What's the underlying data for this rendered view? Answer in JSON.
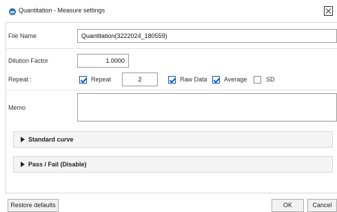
{
  "window": {
    "title": "Quantitation - Measure settings",
    "app_icon": "app-logo-icon",
    "close_icon": "close-icon"
  },
  "form": {
    "file_name": {
      "label": "File Name",
      "value": "Quantitation(3222024_180559)"
    },
    "dilution_factor": {
      "label": "Dilution Factor",
      "value": "1.0000"
    },
    "repeat": {
      "label": "Repeat :",
      "repeat_checkbox": {
        "label": "Repeat",
        "checked": true
      },
      "count": "2",
      "raw_data": {
        "label": "Raw Data",
        "checked": true
      },
      "average": {
        "label": "Average",
        "checked": true
      },
      "sd": {
        "label": "SD",
        "checked": false
      }
    },
    "memo": {
      "label": "Memo",
      "value": ""
    }
  },
  "sections": {
    "standard_curve": {
      "label": "Standard curve",
      "icon": "expand-triangle-icon"
    },
    "pass_fail": {
      "label": "Pass / Fail (Disable)",
      "icon": "expand-triangle-icon"
    }
  },
  "footer": {
    "restore_defaults": "Restore defaults",
    "ok": "OK",
    "cancel": "Cancel"
  },
  "colors": {
    "accent": "#0a5cc2",
    "section_bg": "#f4f4f4"
  }
}
